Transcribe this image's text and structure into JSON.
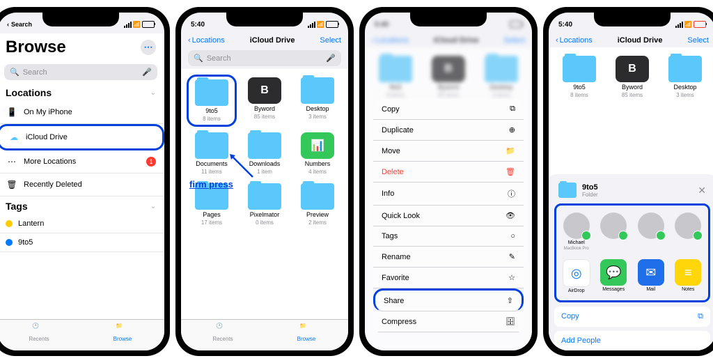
{
  "status": {
    "time": "5:40",
    "back": "Search"
  },
  "screen1": {
    "title": "Browse",
    "search_placeholder": "Search",
    "locations_header": "Locations",
    "rows": {
      "on_my_iphone": "On My iPhone",
      "icloud_drive": "iCloud Drive",
      "more_locations": "More Locations",
      "recently_deleted": "Recently Deleted",
      "badge": "1"
    },
    "tags_header": "Tags",
    "tags": {
      "lantern": "Lantern",
      "nine2five": "9to5"
    }
  },
  "screen2": {
    "back": "Locations",
    "title": "iCloud Drive",
    "select": "Select",
    "search_placeholder": "Search",
    "annotation": "firm press",
    "folders": [
      {
        "name": "9to5",
        "count": "8 items"
      },
      {
        "name": "Byword",
        "count": "85 items",
        "letter": "B"
      },
      {
        "name": "Desktop",
        "count": "3 items"
      },
      {
        "name": "Documents",
        "count": "11 items"
      },
      {
        "name": "Downloads",
        "count": "1 item"
      },
      {
        "name": "Numbers",
        "count": "4 items",
        "app": "numbers"
      },
      {
        "name": "Pages",
        "count": "17 items"
      },
      {
        "name": "Pixelmator",
        "count": "0 items"
      },
      {
        "name": "Preview",
        "count": "2 items"
      }
    ]
  },
  "screen3": {
    "menu": [
      {
        "label": "Copy",
        "icon": "⧉"
      },
      {
        "label": "Duplicate",
        "icon": "⊕"
      },
      {
        "label": "Move",
        "icon": "📁"
      },
      {
        "label": "Delete",
        "icon": "🗑",
        "danger": true
      },
      {
        "label": "Info",
        "icon": "ⓘ"
      },
      {
        "label": "Quick Look",
        "icon": "👁"
      },
      {
        "label": "Tags",
        "icon": "○"
      },
      {
        "label": "Rename",
        "icon": "✎"
      },
      {
        "label": "Favorite",
        "icon": "☆"
      },
      {
        "label": "Share",
        "icon": "⇧",
        "highlight": true
      },
      {
        "label": "Compress",
        "icon": "🗄"
      }
    ]
  },
  "screen4": {
    "back": "Locations",
    "title": "iCloud Drive",
    "select": "Select",
    "share_item": "9to5",
    "share_sub": "Folder",
    "contacts": [
      {
        "name": "Michael",
        "sub": "MacBook Pro"
      },
      {
        "name": ""
      },
      {
        "name": ""
      },
      {
        "name": ""
      }
    ],
    "apps": [
      {
        "name": "AirDrop",
        "color": "#fff",
        "icon": "◎"
      },
      {
        "name": "Messages",
        "color": "#34c759",
        "icon": "💬"
      },
      {
        "name": "Mail",
        "color": "#1f6feb",
        "icon": "✉"
      },
      {
        "name": "Notes",
        "color": "#ffd60a",
        "icon": "≡"
      }
    ],
    "copy": "Copy",
    "add_people": "Add People"
  },
  "tabs": {
    "recents": "Recents",
    "browse": "Browse"
  }
}
